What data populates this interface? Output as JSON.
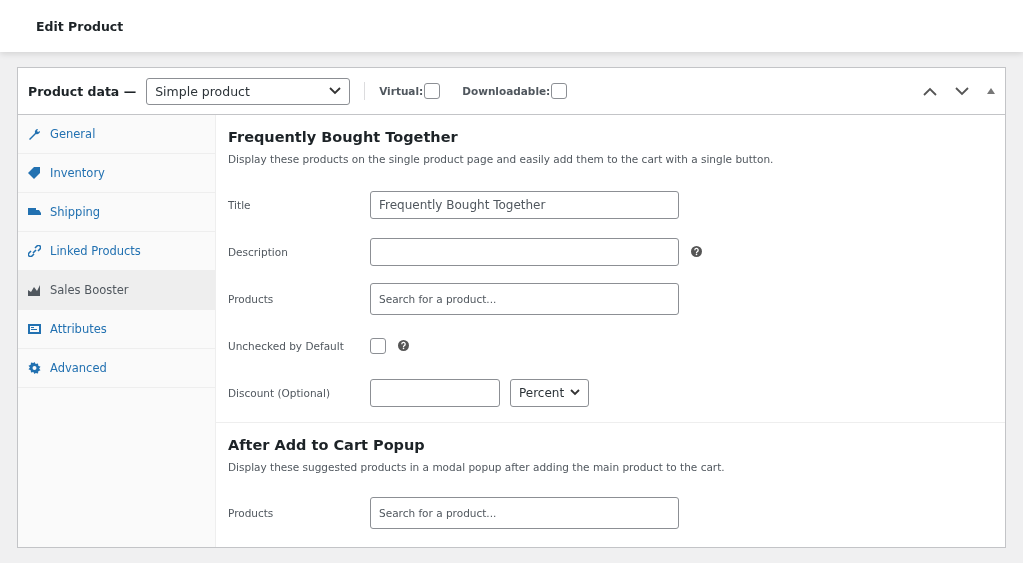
{
  "page": {
    "title": "Edit Product"
  },
  "product_data": {
    "label": "Product data —",
    "type": "Simple product",
    "options": [
      {
        "label": "Virtual:",
        "checked": false
      },
      {
        "label": "Downloadable:",
        "checked": false
      }
    ]
  },
  "tabs": [
    {
      "label": "General",
      "selected": false
    },
    {
      "label": "Inventory",
      "selected": false
    },
    {
      "label": "Shipping",
      "selected": false
    },
    {
      "label": "Linked Products",
      "selected": false
    },
    {
      "label": "Sales Booster",
      "selected": true
    },
    {
      "label": "Attributes",
      "selected": false
    },
    {
      "label": "Advanced",
      "selected": false
    }
  ],
  "sections": [
    {
      "title": "Frequently Bought Together",
      "description": "Display these products on the single product page and easily add them to the cart with a single button.",
      "fields": [
        {
          "label": "Title",
          "kind": "text",
          "value": "Frequently Bought Together",
          "help": false
        },
        {
          "label": "Description",
          "kind": "text",
          "help": true
        },
        {
          "label": "Products",
          "kind": "search",
          "placeholder": "Search for a product...",
          "help": false
        },
        {
          "label": "Unchecked by Default",
          "kind": "checkbox",
          "checked": false,
          "help": true
        },
        {
          "label": "Discount (Optional)",
          "kind": "discount",
          "select": "Percent",
          "help": false
        }
      ]
    },
    {
      "title": "After Add to Cart Popup",
      "description": "Display these suggested products in a modal popup after adding the main product to the cart.",
      "fields": [
        {
          "label": "Products",
          "kind": "search",
          "placeholder": "Search for a product...",
          "help": false
        }
      ]
    }
  ]
}
